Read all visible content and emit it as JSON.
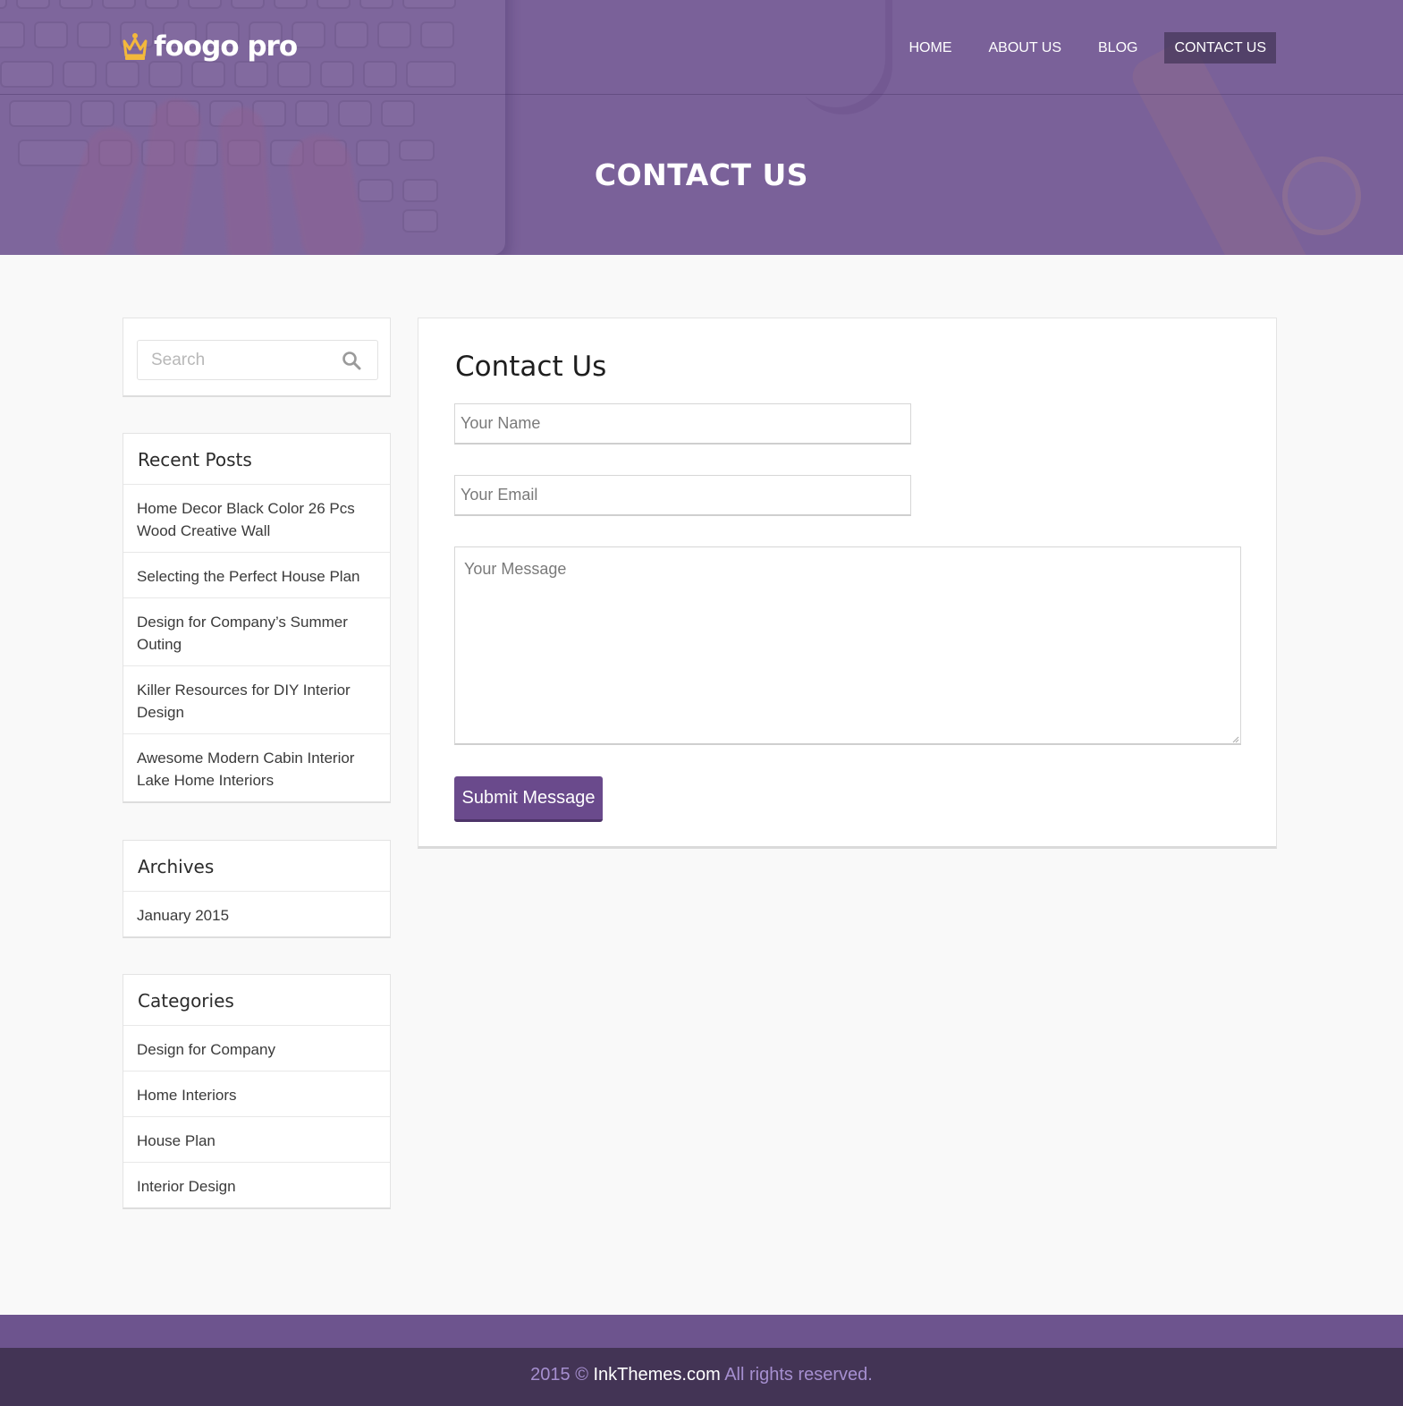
{
  "brand": {
    "logo_text": "foogo pro",
    "accent_color": "#6a4a8c",
    "logo_icon_color": "#f3b83c"
  },
  "nav": {
    "items": [
      {
        "label": "HOME"
      },
      {
        "label": "ABOUT US"
      },
      {
        "label": "BLOG"
      },
      {
        "label": "CONTACT US",
        "active": true
      }
    ]
  },
  "hero": {
    "title": "CONTACT US"
  },
  "sidebar": {
    "search": {
      "placeholder": "Search"
    },
    "recent_posts": {
      "title": "Recent Posts",
      "items": [
        "Home Decor Black Color 26 Pcs Wood Creative Wall",
        "Selecting the Perfect House Plan",
        "Design for Company’s Summer Outing",
        "Killer Resources for DIY Interior Design",
        "Awesome Modern Cabin Interior Lake Home Interiors"
      ]
    },
    "archives": {
      "title": "Archives",
      "items": [
        "January 2015"
      ]
    },
    "categories": {
      "title": "Categories",
      "items": [
        "Design for Company",
        "Home Interiors",
        "House Plan",
        "Interior Design"
      ]
    }
  },
  "contact_form": {
    "title": "Contact Us",
    "name_placeholder": "Your Name",
    "email_placeholder": "Your Email",
    "message_placeholder": "Your Message",
    "submit_label": "Submit Message"
  },
  "footer": {
    "prefix": "2015 © ",
    "brand": "InkThemes.com",
    "suffix": " All rights reserved."
  }
}
